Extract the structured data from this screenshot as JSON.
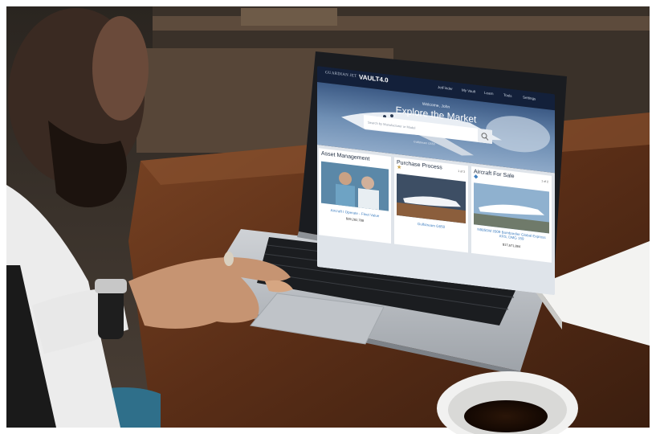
{
  "screen": {
    "nav": {
      "logo_text": "GUARDIAN JET",
      "product": "VAULT4.0",
      "menu": [
        "JetFinder",
        "My Vault",
        "Learn",
        "Tools",
        "Settings"
      ]
    },
    "hero": {
      "welcome": "Welcome, John",
      "title": "Explore the Market",
      "search_placeholder": "Search by Manufacturer or Model",
      "image_caption": "Gulfstream G650"
    },
    "cards": [
      {
        "title": "Asset Management",
        "link": "Aircraft I Operate - Fleet Value",
        "price": "$39,282,788"
      },
      {
        "title": "Purchase Process",
        "pager": "1 of 3",
        "link": "Gulfstream G650"
      },
      {
        "title": "Aircraft For Sale",
        "pager": "1 of 2",
        "link": "N985DM 2009 Bombardier Global Express XRS, DMG 159",
        "price": "$17,671,884"
      }
    ]
  },
  "colors": {
    "nav_bg": "#13203a",
    "hero_sky": "#6f8fb4",
    "link": "#3f7fc0",
    "table_wood": "#5a2e17"
  },
  "icons": [
    "search-icon",
    "star-icon",
    "tag-icon",
    "chevron-down-icon"
  ]
}
